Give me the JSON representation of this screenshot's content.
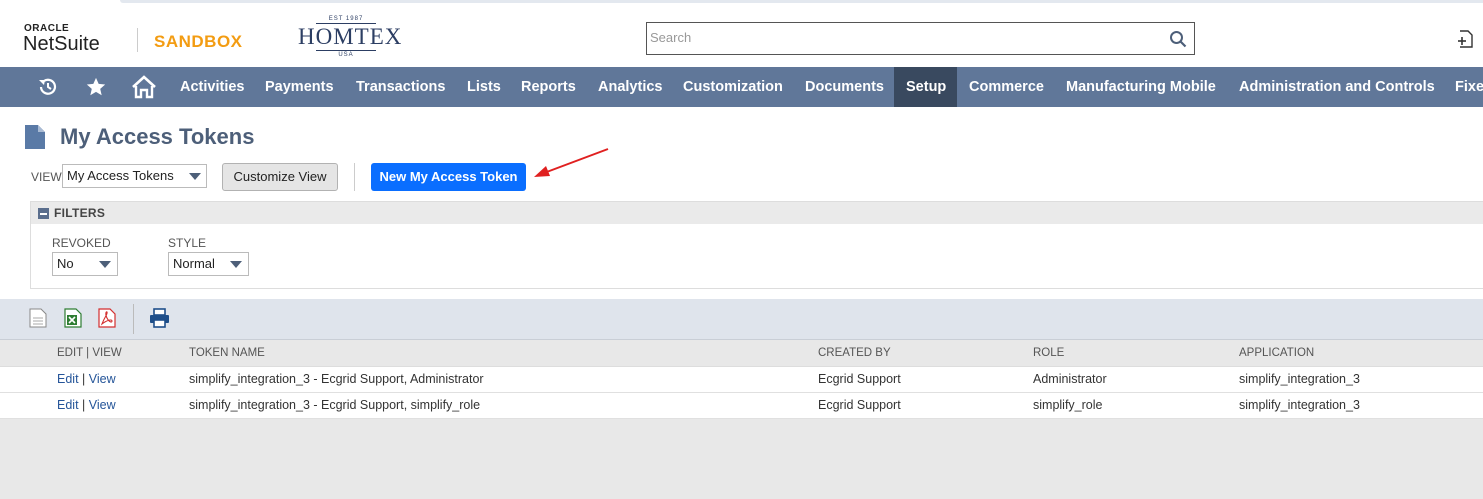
{
  "header": {
    "oracle": "ORACLE",
    "netsuite": "NetSuite",
    "sandbox": "SANDBOX",
    "company": {
      "est": "EST 1987",
      "name": "HOMTEX",
      "country": "USA"
    },
    "search": {
      "placeholder": "Search",
      "value": ""
    }
  },
  "nav": {
    "items": [
      {
        "label": "Activities"
      },
      {
        "label": "Payments"
      },
      {
        "label": "Transactions"
      },
      {
        "label": "Lists"
      },
      {
        "label": "Reports"
      },
      {
        "label": "Analytics"
      },
      {
        "label": "Customization"
      },
      {
        "label": "Documents"
      },
      {
        "label": "Setup",
        "active": true
      },
      {
        "label": "Commerce"
      },
      {
        "label": "Manufacturing Mobile"
      },
      {
        "label": "Administration and Controls"
      },
      {
        "label": "Fixe"
      }
    ]
  },
  "page": {
    "title": "My Access Tokens",
    "view_label": "VIEW",
    "view_value": "My Access Tokens",
    "customize_view": "Customize View",
    "new_button": "New My Access Token"
  },
  "filters": {
    "title": "FILTERS",
    "revoked_label": "REVOKED",
    "revoked_value": "No",
    "style_label": "STYLE",
    "style_value": "Normal"
  },
  "table": {
    "headers": [
      "EDIT | VIEW",
      "TOKEN NAME",
      "CREATED BY",
      "ROLE",
      "APPLICATION"
    ],
    "rows": [
      {
        "edit": "Edit",
        "view": "View",
        "token_name": "simplify_integration_3 - Ecgrid Support, Administrator",
        "created_by": "Ecgrid Support",
        "role": "Administrator",
        "application": "simplify_integration_3"
      },
      {
        "edit": "Edit",
        "view": "View",
        "token_name": "simplify_integration_3 - Ecgrid Support, simplify_role",
        "created_by": "Ecgrid Support",
        "role": "simplify_role",
        "application": "simplify_integration_3"
      }
    ]
  },
  "colors": {
    "nav_bg": "#607799",
    "nav_active": "#39495f",
    "primary_button": "#0a6eff",
    "sandbox": "#f39c12",
    "annotation_arrow": "#e02020"
  }
}
